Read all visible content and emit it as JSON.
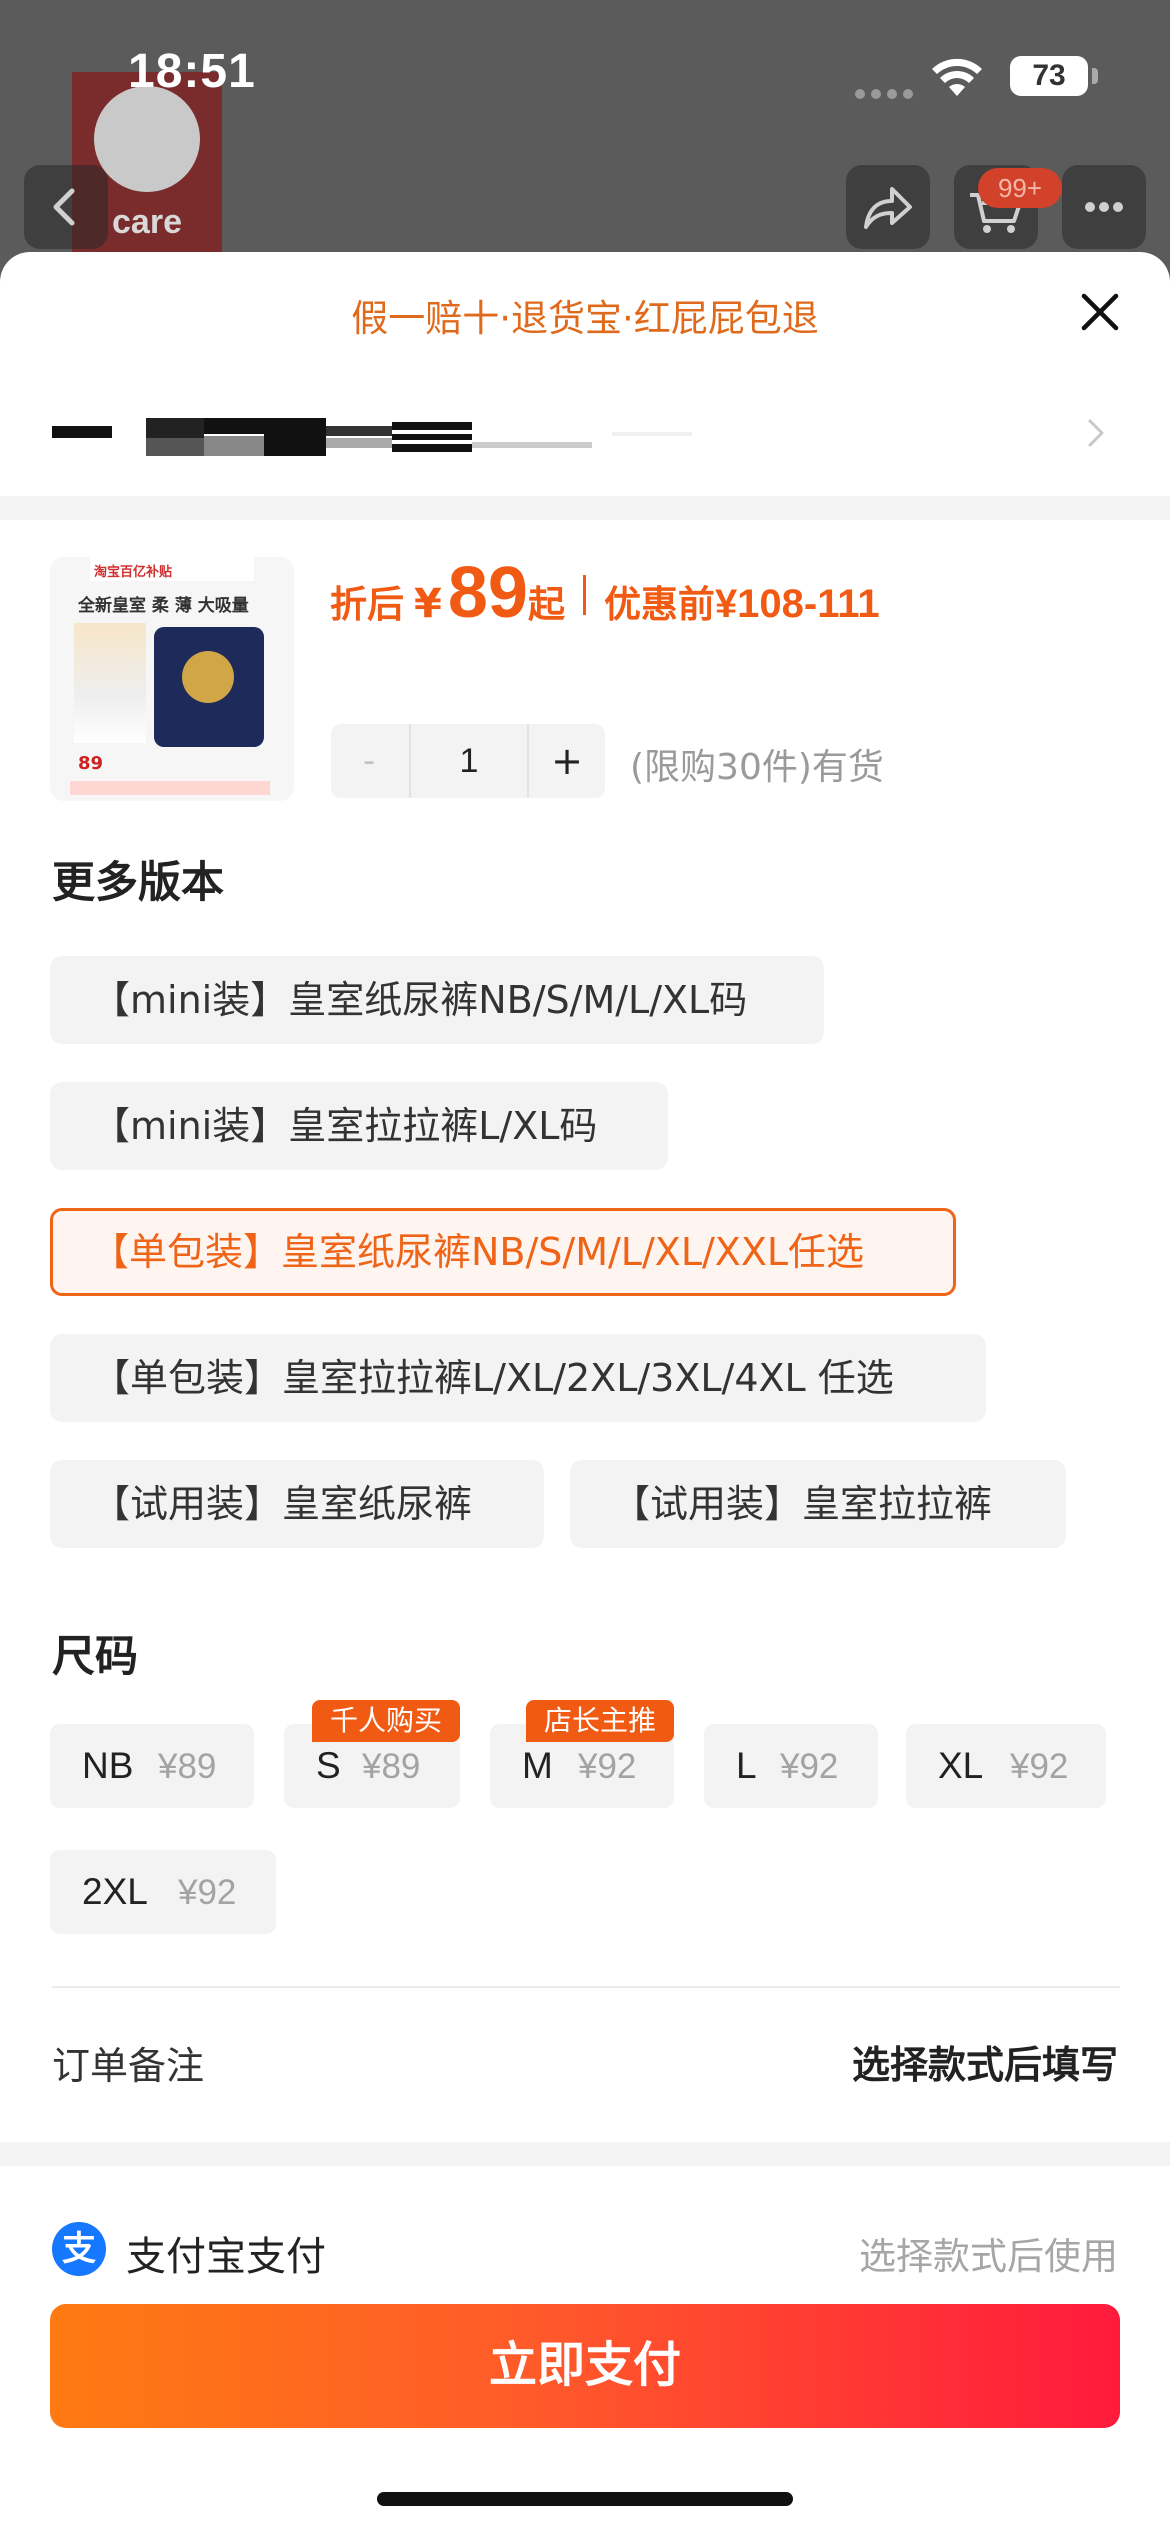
{
  "status_bar": {
    "time": "18:51",
    "battery": "73"
  },
  "background_page": {
    "logo_text": "care",
    "cart_badge": "99+"
  },
  "sheet": {
    "title": "假一赔十·退货宝·红屁屁包退"
  },
  "product": {
    "image": {
      "brand_text": "淘宝百亿补贴",
      "headline": "全新皇室 柔 薄 大吸量",
      "price": "89"
    },
    "price_label": "折后",
    "currency": "¥",
    "price": "89",
    "price_suffix": "起",
    "original_label": "优惠前",
    "original_price": "¥108-111"
  },
  "quantity": {
    "minus": "-",
    "value": "1",
    "plus": "+",
    "stock_text": "(限购30件)有货"
  },
  "versions": {
    "title": "更多版本",
    "items": [
      "【mini装】皇室纸尿裤NB/S/M/L/XL码",
      "【mini装】皇室拉拉裤L/XL码",
      "【单包装】皇室纸尿裤NB/S/M/L/XL/XXL任选",
      "【单包装】皇室拉拉裤L/XL/2XL/3XL/4XL 任选",
      "【试用装】皇室纸尿裤",
      "【试用装】皇室拉拉裤"
    ],
    "selected_index": 2
  },
  "sizes": {
    "title": "尺码",
    "items": [
      {
        "size": "NB",
        "price": "¥89"
      },
      {
        "size": "S",
        "price": "¥89",
        "tag": "千人购买"
      },
      {
        "size": "M",
        "price": "¥92",
        "tag": "店长主推"
      },
      {
        "size": "L",
        "price": "¥92"
      },
      {
        "size": "XL",
        "price": "¥92"
      },
      {
        "size": "2XL",
        "price": "¥92"
      }
    ]
  },
  "order_note": {
    "label": "订单备注",
    "value": "选择款式后填写"
  },
  "payment": {
    "method": "支付宝支付",
    "icon_char": "支",
    "hint": "选择款式后使用",
    "button_label": "立即支付"
  },
  "colors": {
    "accent": "#f05a12",
    "selected_border": "#f06418",
    "alipay": "#1677ff",
    "pay_gradient_start": "#ff7a12",
    "pay_gradient_end": "#ff1a3c"
  }
}
